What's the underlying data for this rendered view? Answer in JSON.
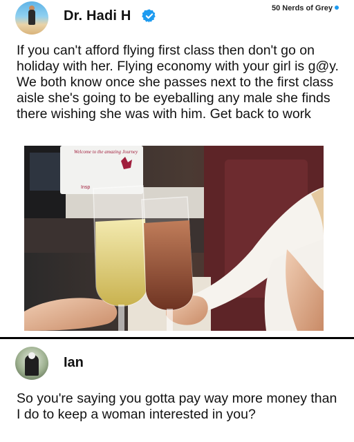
{
  "post": {
    "author": "Dr. Hadi H",
    "verified_icon": "verified-badge-icon",
    "watermark": "50 Nerds of Grey",
    "text": "If you can't afford flying first class then don't go on holiday with her. Flying economy with your girl is g@y. We both know once she passes next to the first class aisle she's going to be eyeballing any male she finds there wishing she was with him. Get back to work",
    "photo_card_text": "Welcome to the amazing Journey",
    "photo_card_subtext": "Insp"
  },
  "reply": {
    "author": "Ian",
    "text": "So you're saying you gotta pay way more money than I do to keep a woman interested in you?"
  },
  "colors": {
    "verified": "#1d9bf0",
    "divider": "#000000",
    "text": "#111111"
  }
}
